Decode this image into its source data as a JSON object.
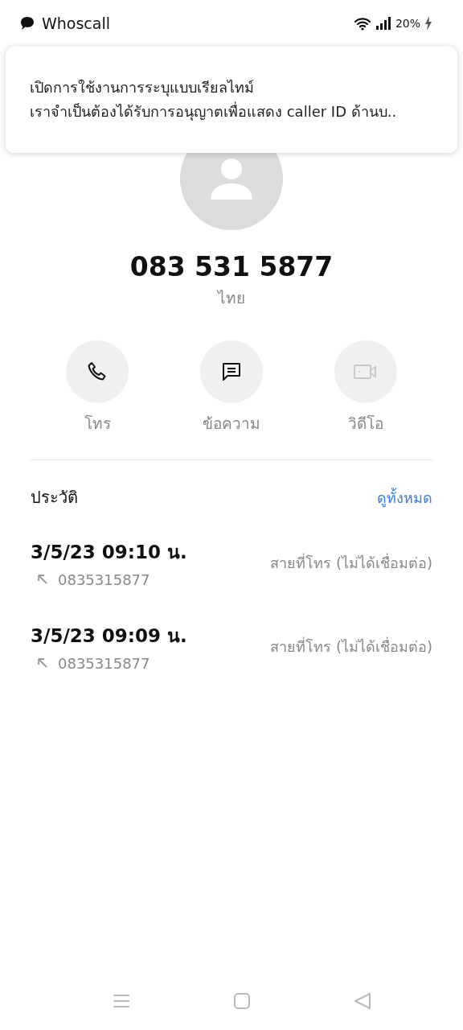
{
  "status_bar": {
    "app_name": "Whoscall",
    "battery": "20%",
    "charging": true
  },
  "notification": {
    "title": "เปิดการใช้งานการระบุแบบเรียลไทม์",
    "body": "เราจำเป็นต้องได้รับการอนุญาตเพื่อแสดง caller ID ด้านบ.."
  },
  "contact": {
    "number": "083 531 5877",
    "country": "ไทย"
  },
  "actions": [
    {
      "kind": "call",
      "label": "โทร",
      "disabled": false
    },
    {
      "kind": "message",
      "label": "ข้อความ",
      "disabled": false
    },
    {
      "kind": "video",
      "label": "วิดีโอ",
      "disabled": true
    }
  ],
  "history": {
    "title": "ประวัติ",
    "link": "ดูทั้งหมด",
    "rows": [
      {
        "time": "3/5/23 09:10 น.",
        "number": "0835315877",
        "status": "สายที่โทร (ไม่ได้เชื่อมต่อ)"
      },
      {
        "time": "3/5/23 09:09 น.",
        "number": "0835315877",
        "status": "สายที่โทร (ไม่ได้เชื่อมต่อ)"
      }
    ]
  }
}
